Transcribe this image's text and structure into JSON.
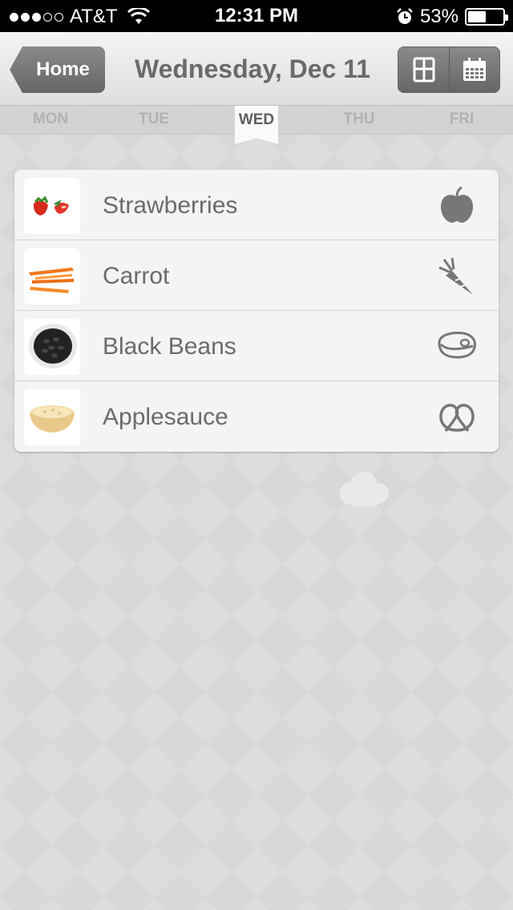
{
  "status_bar": {
    "carrier": "AT&T",
    "signal_bars": 3,
    "signal_total": 5,
    "time": "12:31 PM",
    "battery_percent": "53%",
    "battery_level": 0.53
  },
  "nav": {
    "back_label": "Home",
    "title": "Wednesday, Dec 11",
    "view_options": [
      {
        "icon": "grid-view-icon"
      },
      {
        "icon": "calendar-icon"
      }
    ]
  },
  "days": [
    {
      "label": "MON"
    },
    {
      "label": "TUE"
    },
    {
      "label": "WED",
      "selected": true
    },
    {
      "label": "THU"
    },
    {
      "label": "FRI"
    }
  ],
  "foods": [
    {
      "name": "Strawberries",
      "thumb": "strawberries-image",
      "type_icon": "apple-icon"
    },
    {
      "name": "Carrot",
      "thumb": "carrot-image",
      "type_icon": "carrot-icon"
    },
    {
      "name": "Black Beans",
      "thumb": "black-beans-image",
      "type_icon": "meat-icon"
    },
    {
      "name": "Applesauce",
      "thumb": "applesauce-image",
      "type_icon": "pretzel-icon"
    }
  ],
  "colors": {
    "accent_button": "#777777",
    "text": "#6b6b6b",
    "background": "#d8d8d8"
  }
}
